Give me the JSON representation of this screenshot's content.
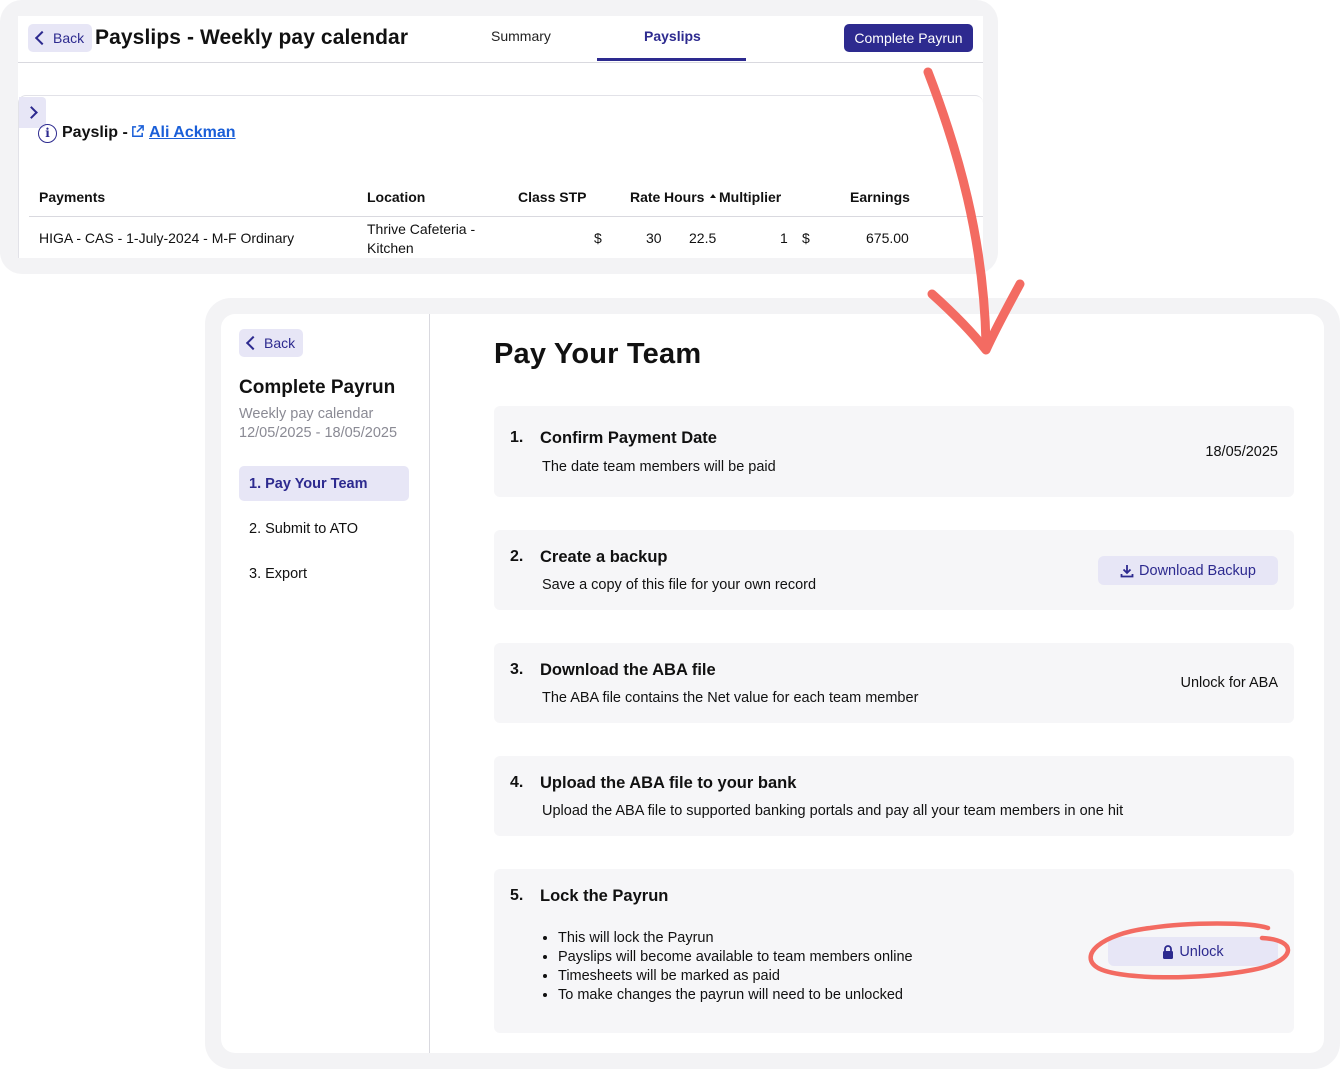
{
  "payslips_screen": {
    "back_label": "Back",
    "title": "Payslips - Weekly pay calendar",
    "tabs": [
      {
        "label": "Summary",
        "active": false
      },
      {
        "label": "Payslips",
        "active": true
      }
    ],
    "complete_button": "Complete Payrun",
    "payslip_label": "Payslip -",
    "employee_name": "Ali Ackman",
    "table": {
      "headers": [
        "Payments",
        "Location",
        "Class STP",
        "Rate",
        "Hours",
        "Multiplier",
        "Earnings"
      ],
      "rows": [
        {
          "payment": "HIGA - CAS - 1-July-2024 - M-F Ordinary",
          "location_line1": "Thrive Cafeteria -",
          "location_line2": "Kitchen",
          "rate_currency": "$",
          "rate": "30",
          "hours": "22.5",
          "multiplier": "1",
          "earnings_currency": "$",
          "earnings": "675.00"
        }
      ]
    }
  },
  "complete_payrun_screen": {
    "back_label": "Back",
    "sidebar": {
      "title": "Complete Payrun",
      "calendar": "Weekly pay calendar",
      "period": "12/05/2025 - 18/05/2025",
      "steps": [
        {
          "label": "1. Pay Your Team",
          "active": true
        },
        {
          "label": "2. Submit to ATO",
          "active": false
        },
        {
          "label": "3. Export",
          "active": false
        }
      ]
    },
    "main_title": "Pay Your Team",
    "steps": [
      {
        "number": "1.",
        "title": "Confirm Payment Date",
        "description": "The date team members will be paid",
        "right_text": "18/05/2025"
      },
      {
        "number": "2.",
        "title": "Create a backup",
        "description": "Save a copy of this file for your own record",
        "button": "Download Backup"
      },
      {
        "number": "3.",
        "title": "Download the ABA file",
        "description": "The ABA file contains the Net value for each team member",
        "right_text": "Unlock for ABA"
      },
      {
        "number": "4.",
        "title": "Upload the ABA file to your bank",
        "description": "Upload the ABA file to supported banking portals and pay all your team members in one hit"
      },
      {
        "number": "5.",
        "title": "Lock the Payrun",
        "bullets": [
          "This will lock the Payrun",
          "Payslips will become available to team members online",
          "Timesheets will be marked as paid",
          "To make changes the payrun will need to be unlocked"
        ],
        "button": "Unlock"
      }
    ]
  },
  "colors": {
    "brand": "#2d2a8f",
    "accent_light": "#e7e6f6",
    "annotation": "#f36b62",
    "link": "#1a5fd8"
  }
}
